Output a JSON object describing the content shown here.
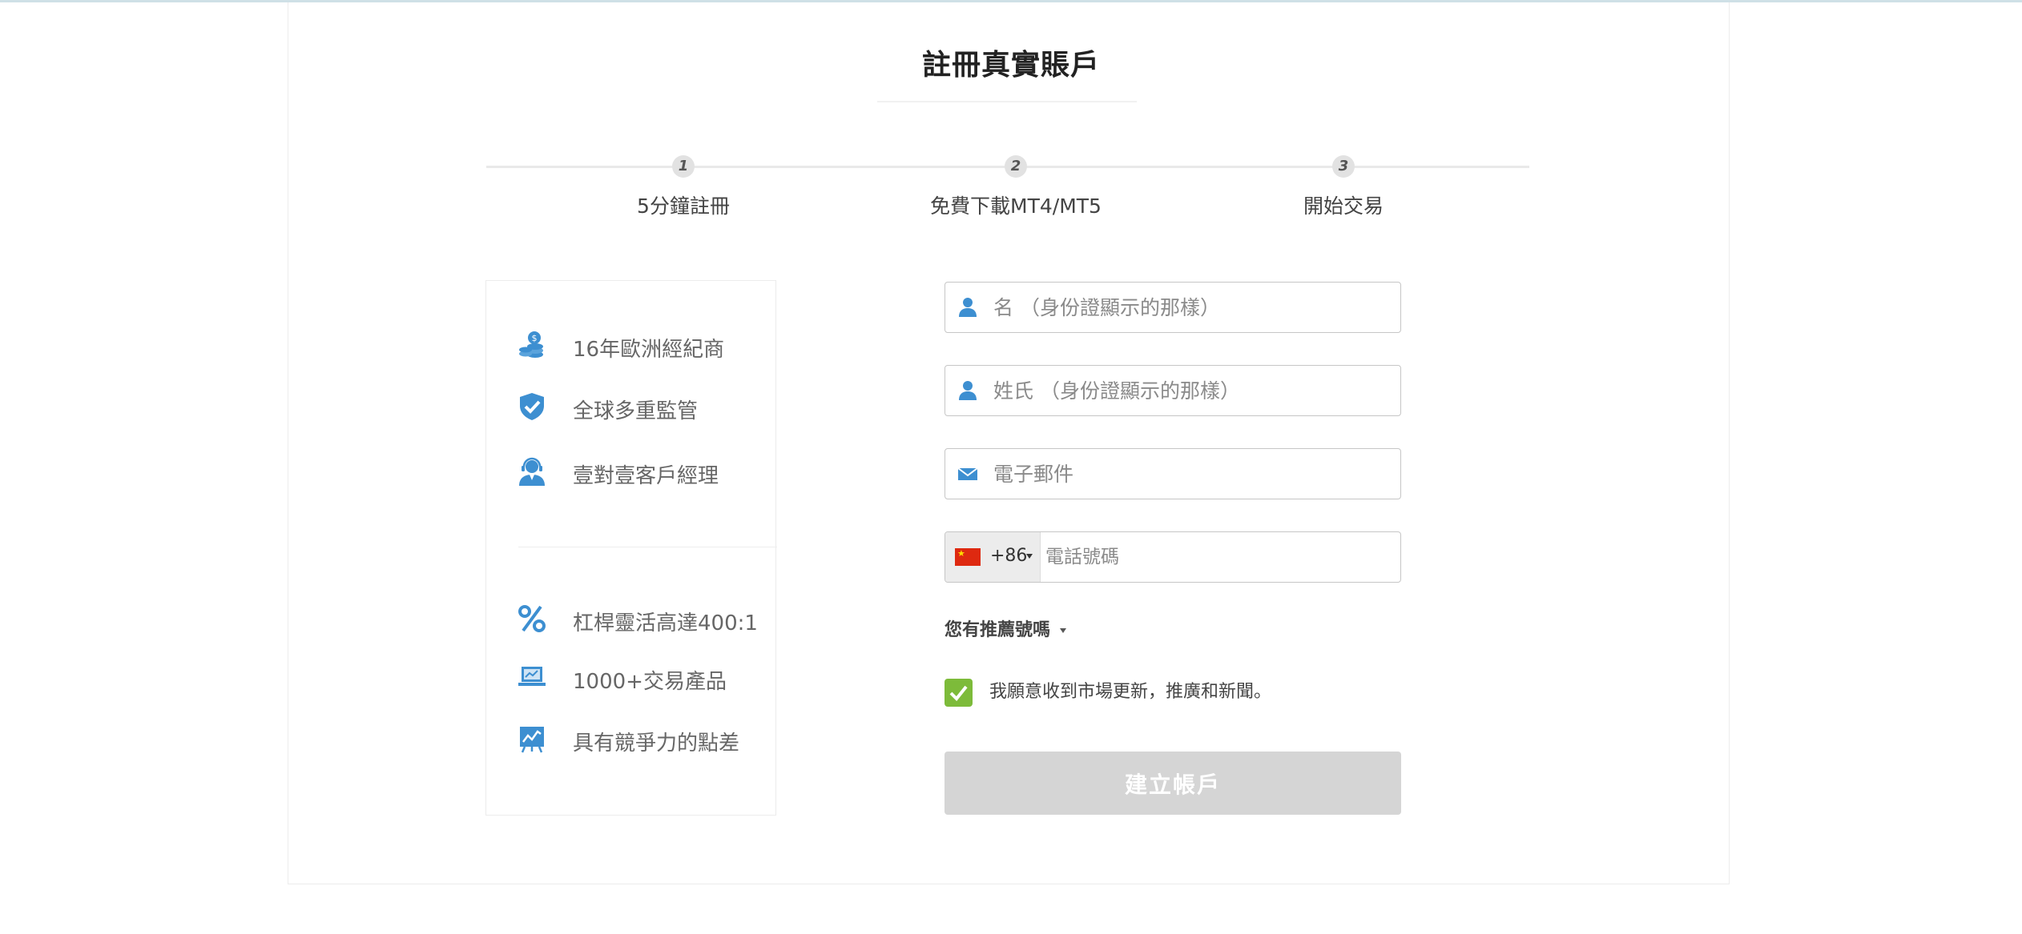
{
  "page": {
    "title": "註冊真實賬戶"
  },
  "steps": [
    {
      "number": "1",
      "label": "5分鐘註冊"
    },
    {
      "number": "2",
      "label": "免費下載MT4/MT5"
    },
    {
      "number": "3",
      "label": "開始交易"
    }
  ],
  "features": {
    "group1": [
      {
        "icon": "coins-icon",
        "label": "16年歐洲經紀商"
      },
      {
        "icon": "shield-check-icon",
        "label": "全球多重監管"
      },
      {
        "icon": "headset-agent-icon",
        "label": "壹對壹客戶經理"
      }
    ],
    "group2": [
      {
        "icon": "percent-icon",
        "label": "杠桿靈活高達400:1"
      },
      {
        "icon": "laptop-chart-icon",
        "label": "1000+交易產品"
      },
      {
        "icon": "chart-board-icon",
        "label": "具有競爭力的點差"
      }
    ]
  },
  "form": {
    "first_name_placeholder": "名 （身份證顯示的那樣）",
    "last_name_placeholder": "姓氏 （身份證顯示的那樣）",
    "email_placeholder": "電子郵件",
    "phone": {
      "dial_code": "+86",
      "placeholder": "電話號碼"
    },
    "referral_label": "您有推薦號嗎",
    "consent_label": "我願意收到市場更新，推廣和新聞。",
    "consent_checked": true,
    "submit_label": "建立帳戶"
  },
  "colors": {
    "accent_blue": "#3d8fd1",
    "checkbox_green": "#7dbb3a",
    "submit_disabled": "#d5d5d5",
    "flag_red": "#de2910"
  }
}
